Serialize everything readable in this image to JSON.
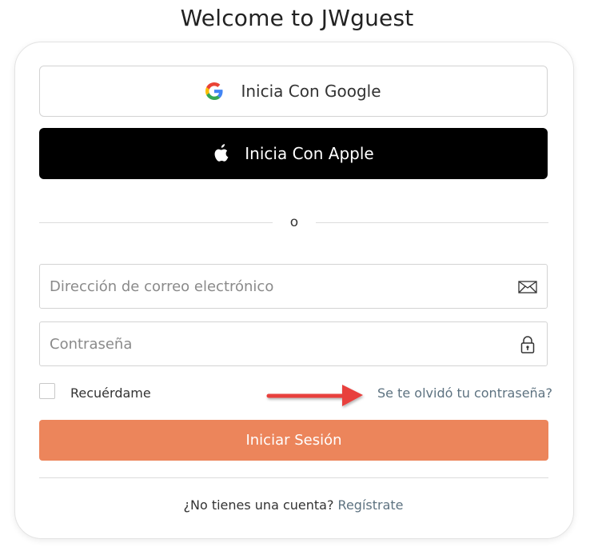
{
  "page_title": "Welcome to JWguest",
  "social": {
    "google_label": "Inicia Con Google",
    "google_icon": "google-g-icon",
    "apple_label": "Inicia Con Apple",
    "apple_icon": "apple-logo-icon"
  },
  "divider_text": "o",
  "form": {
    "email_placeholder": "Dirección de correo electrónico",
    "email_value": "",
    "email_icon": "envelope-icon",
    "password_placeholder": "Contraseña",
    "password_value": "",
    "password_icon": "lock-icon",
    "remember_label": "Recuérdame",
    "remember_checked": false,
    "forgot_label": "Se te olvidó tu contraseña?",
    "submit_label": "Iniciar Sesión"
  },
  "signup": {
    "prompt": "¿No tienes una cuenta?",
    "link_label": "Regístrate"
  },
  "colors": {
    "submit_bg": "#ec855b",
    "apple_bg": "#000000",
    "link": "#5d7280",
    "annotation_arrow": "#e8403e"
  }
}
